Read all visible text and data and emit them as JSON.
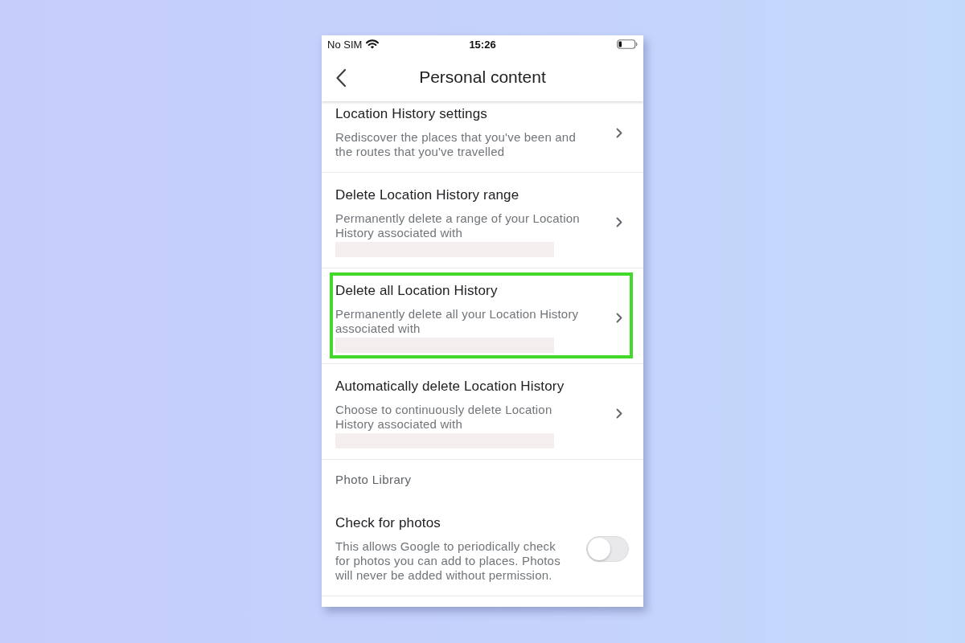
{
  "status_bar": {
    "carrier": "No SIM",
    "time": "15:26"
  },
  "header": {
    "title": "Personal content"
  },
  "sections": [
    {
      "items": [
        {
          "kind": "link",
          "title": "Location History settings",
          "description": "Rediscover the places that you've been and the routes that you've travelled",
          "redacted": false,
          "highlighted": false
        },
        {
          "kind": "link",
          "title": "Delete Location History range",
          "description": "Permanently delete a range of your Location History associated with",
          "redacted": true,
          "highlighted": false
        },
        {
          "kind": "link",
          "title": "Delete all Location History",
          "description": "Permanently delete all your Location History associated with",
          "redacted": true,
          "highlighted": true
        },
        {
          "kind": "link",
          "title": "Automatically delete Location History",
          "description": "Choose to continuously delete Location History associated with",
          "redacted": true,
          "highlighted": false
        }
      ]
    },
    {
      "heading": "Photo Library",
      "items": [
        {
          "kind": "toggle",
          "title": "Check for photos",
          "description": "This allows Google to periodically check for photos you can add to places. Photos will never be added without permission.",
          "on": false
        }
      ]
    }
  ]
}
